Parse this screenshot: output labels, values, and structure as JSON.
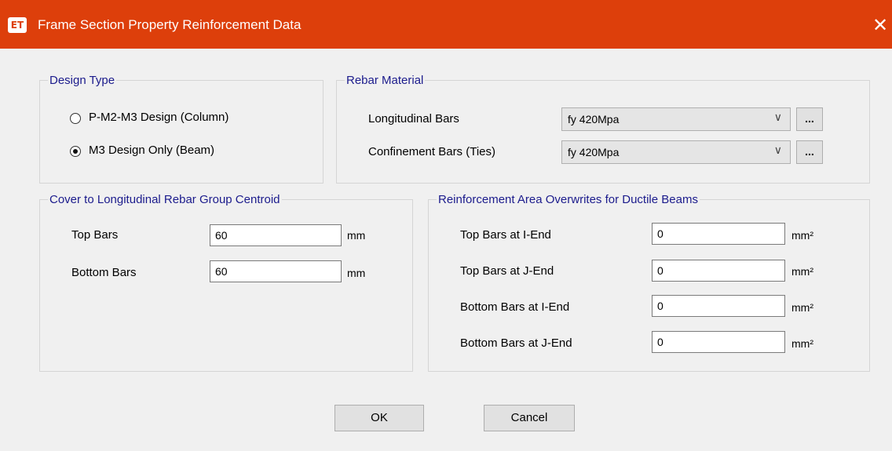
{
  "window": {
    "app_icon_text": "ET",
    "title": "Frame Section Property Reinforcement Data",
    "close_glyph": "✕"
  },
  "design_type": {
    "legend": "Design Type",
    "options": [
      {
        "label": "P-M2-M3 Design  (Column)",
        "selected": false
      },
      {
        "label": "M3 Design Only  (Beam)",
        "selected": true
      }
    ]
  },
  "rebar_material": {
    "legend": "Rebar Material",
    "longitudinal_label": "Longitudinal Bars",
    "longitudinal_value": "fy 420Mpa",
    "confinement_label": "Confinement Bars (Ties)",
    "confinement_value": "fy 420Mpa",
    "ellipsis_label": "...",
    "arrow_glyph": "∨"
  },
  "cover": {
    "legend": "Cover to Longitudinal Rebar Group Centroid",
    "top_label": "Top Bars",
    "top_value": "60",
    "bottom_label": "Bottom  Bars",
    "bottom_value": "60",
    "unit": "mm"
  },
  "overwrites": {
    "legend": "Reinforcement Area Overwrites for Ductile Beams",
    "unit": "mm²",
    "rows": [
      {
        "label": "Top Bars at I-End",
        "value": "0"
      },
      {
        "label": "Top Bars at J-End",
        "value": "0"
      },
      {
        "label": "Bottom Bars at I-End",
        "value": "0"
      },
      {
        "label": "Bottom Bars at J-End",
        "value": "0"
      }
    ]
  },
  "buttons": {
    "ok": "OK",
    "cancel": "Cancel"
  }
}
